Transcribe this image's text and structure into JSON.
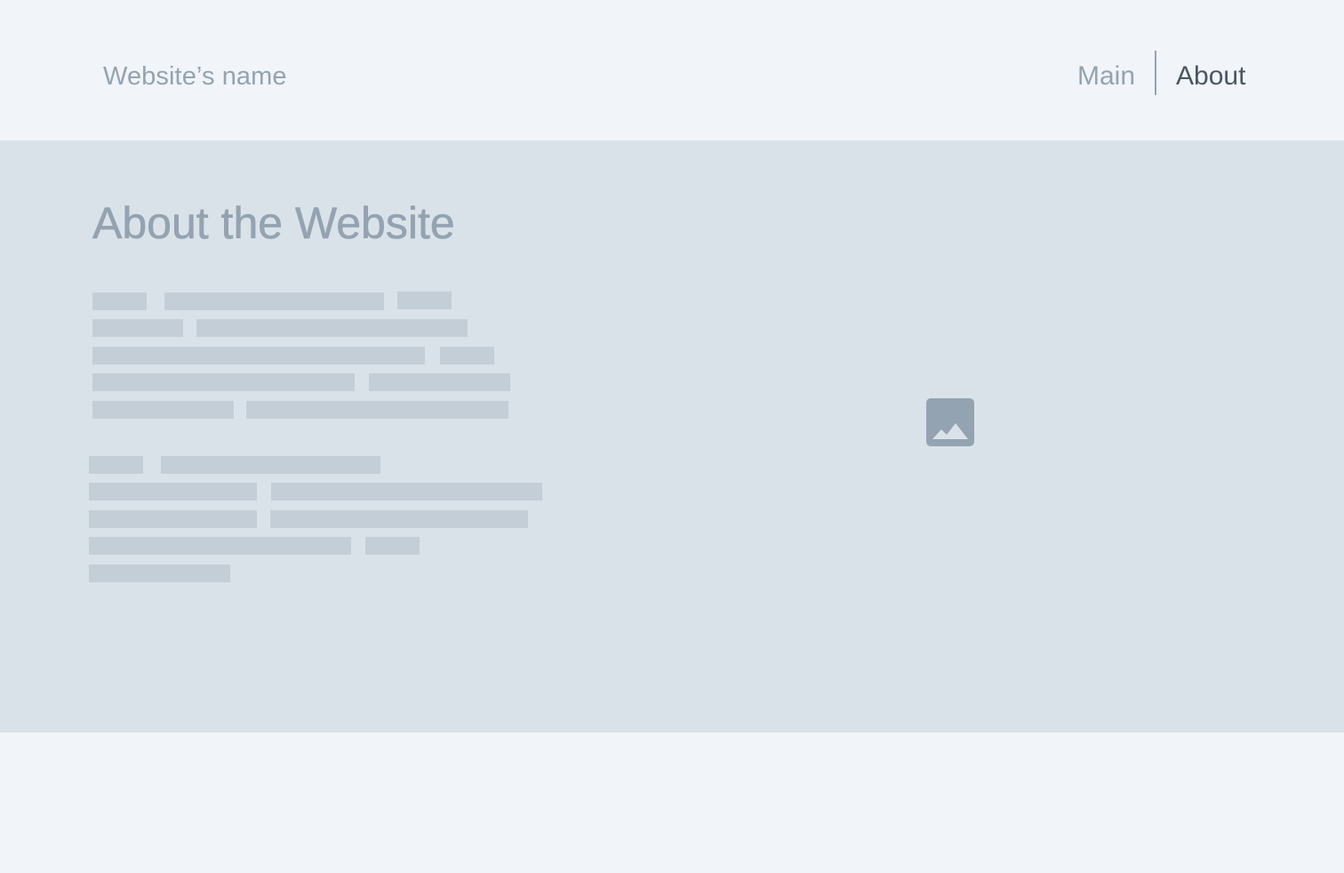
{
  "header": {
    "site_name": "Website’s name",
    "nav": {
      "main_label": "Main",
      "about_label": "About"
    }
  },
  "hero": {
    "title": "About the Website",
    "image_icon": "image-placeholder-icon"
  },
  "colors": {
    "page_bg": "#f1f4f8",
    "hero_bg": "#dae2e9",
    "placeholder_bar": "#c4ced7",
    "muted_text": "#94a3b1",
    "active_nav": "#4b5563"
  }
}
